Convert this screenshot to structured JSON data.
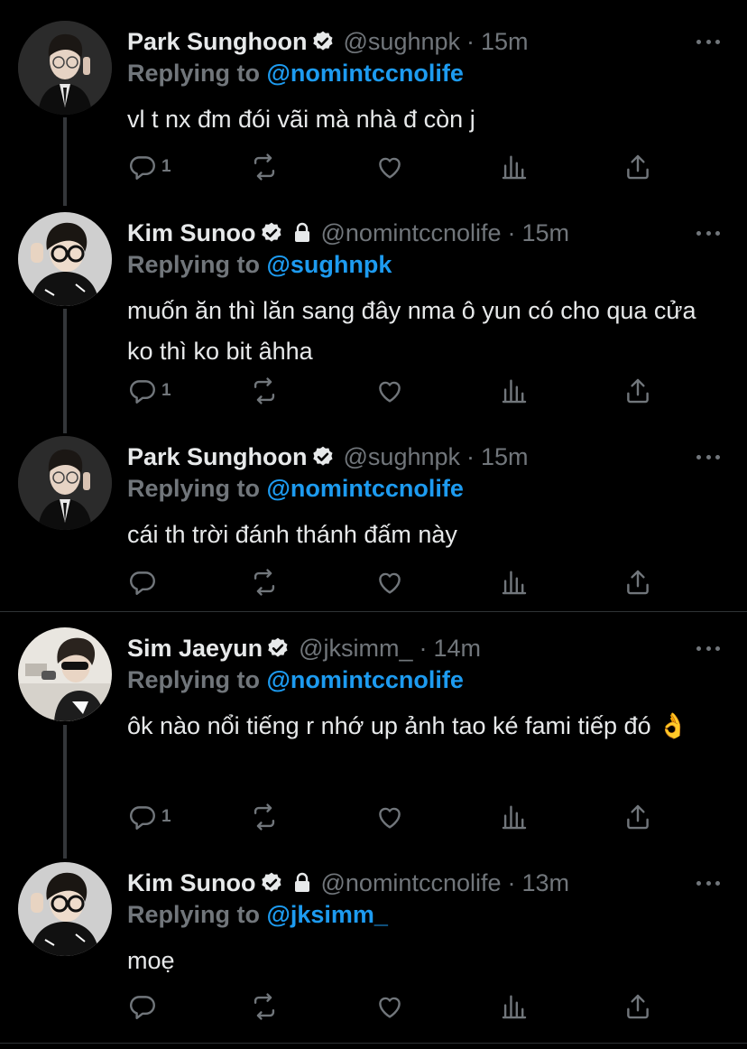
{
  "tweets": [
    {
      "name": "Park Sunghoon",
      "handle": "@sughnpk",
      "dot": "·",
      "time": "15m",
      "verified": true,
      "locked": false,
      "replying_label": "Replying to",
      "replying_to": "@nomintccnolife",
      "text": "vl t nx đm đói vãi mà nhà đ còn j",
      "reply_count": "1",
      "avatar_icon": "profile-photo-sunghoon"
    },
    {
      "name": "Kim Sunoo",
      "handle": "@nomintccnolife",
      "dot": "·",
      "time": "15m",
      "verified": true,
      "locked": true,
      "replying_label": "Replying to",
      "replying_to": "@sughnpk",
      "text": "muốn ăn thì lăn sang đây nma ô yun có cho qua cửa ko thì ko bit âhha",
      "reply_count": "1",
      "avatar_icon": "profile-photo-sunoo"
    },
    {
      "name": "Park Sunghoon",
      "handle": "@sughnpk",
      "dot": "·",
      "time": "15m",
      "verified": true,
      "locked": false,
      "replying_label": "Replying to",
      "replying_to": "@nomintccnolife",
      "text": "cái th trời đánh thánh đấm này",
      "reply_count": "",
      "avatar_icon": "profile-photo-sunghoon"
    },
    {
      "name": "Sim Jaeyun",
      "handle": "@jksimm_",
      "dot": "·",
      "time": "14m",
      "verified": true,
      "locked": false,
      "replying_label": "Replying to",
      "replying_to": "@nomintccnolife",
      "text": "ôk nào nổi tiếng r nhớ up ảnh tao ké fami tiếp đó 👌",
      "reply_count": "1",
      "avatar_icon": "profile-photo-jaeyun"
    },
    {
      "name": "Kim Sunoo",
      "handle": "@nomintccnolife",
      "dot": "·",
      "time": "13m",
      "verified": true,
      "locked": true,
      "replying_label": "Replying to",
      "replying_to": "@jksimm_",
      "text": "moẹ",
      "reply_count": "",
      "avatar_icon": "profile-photo-sunoo"
    }
  ],
  "colors": {
    "background": "#000000",
    "text": "#e7e9ea",
    "muted": "#71767b",
    "accent": "#1d9bf0",
    "separator": "#2f3336"
  },
  "icons": {
    "reply": "reply-icon",
    "retweet": "retweet-icon",
    "like": "heart-icon",
    "views": "analytics-icon",
    "share": "share-icon",
    "more": "more-icon",
    "verified": "verified-badge-icon",
    "lock": "lock-icon"
  }
}
